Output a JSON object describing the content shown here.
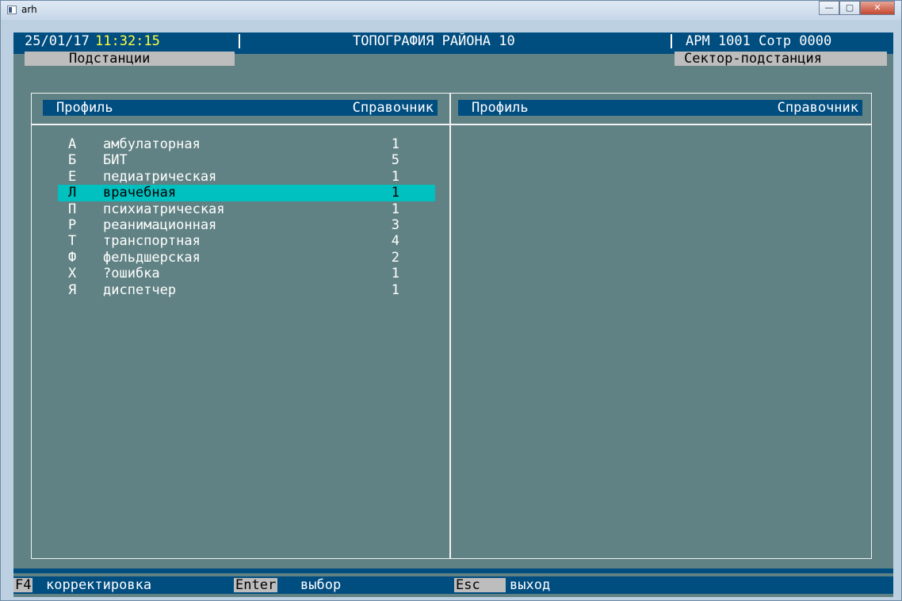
{
  "window": {
    "title": "arh",
    "buttons": {
      "minimize": "—",
      "maximize": "▢",
      "close": "✕"
    }
  },
  "header": {
    "date": "25/01/17",
    "time": "11:32:15",
    "title": "ТОПОГРАФИЯ РАЙОНА 10",
    "arm": "АРМ 1001 Сотр 0000"
  },
  "tabs": {
    "left": "Подстанции",
    "right": "Сектор-подстанция"
  },
  "left_panel": {
    "col_profile": "Профиль",
    "col_reference": "Справочник",
    "selected_index": 3,
    "rows": [
      {
        "code": "А",
        "name": "амбулаторная",
        "value": "1"
      },
      {
        "code": "Б",
        "name": "БИТ",
        "value": "5"
      },
      {
        "code": "Е",
        "name": "педиатрическая",
        "value": "1"
      },
      {
        "code": "Л",
        "name": "врачебная",
        "value": "1"
      },
      {
        "code": "П",
        "name": "психиатрическая",
        "value": "1"
      },
      {
        "code": "Р",
        "name": "реанимационная",
        "value": "3"
      },
      {
        "code": "Т",
        "name": "транспортная",
        "value": "4"
      },
      {
        "code": "Ф",
        "name": "фельдшерская",
        "value": "2"
      },
      {
        "code": "Х",
        "name": "?ошибка",
        "value": "1"
      },
      {
        "code": "Я",
        "name": "диспетчер",
        "value": "1"
      }
    ]
  },
  "right_panel": {
    "col_profile": "Профиль",
    "col_reference": "Справочник"
  },
  "statusbar": {
    "f4_key": "F4",
    "f4_label": "корректировка",
    "enter_key": "Enter",
    "enter_label": "выбор",
    "esc_key": "Esc",
    "esc_label": "выход"
  },
  "colors": {
    "background": "#618284",
    "bar": "#004d80",
    "highlight": "#00c0c0",
    "time": "#ffff3c",
    "key_bg": "#bdbdbd"
  }
}
